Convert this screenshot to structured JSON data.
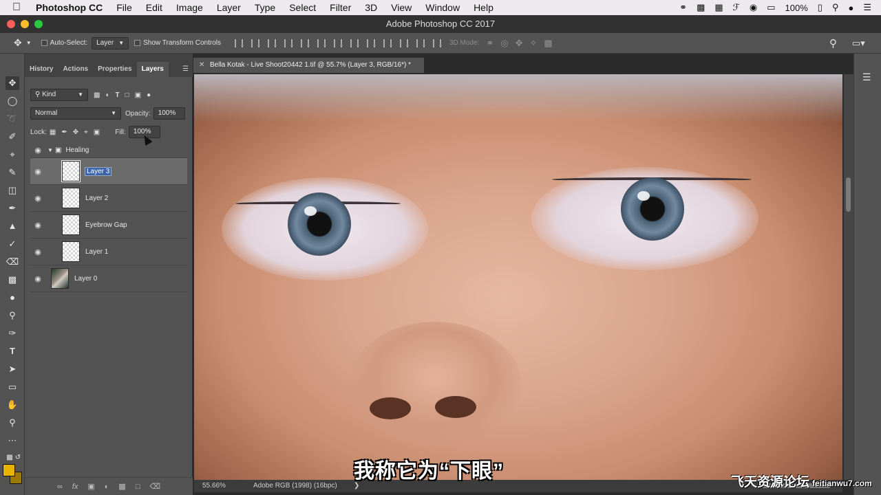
{
  "menubar": {
    "apple_icon": "apple-icon",
    "app_name": "Photoshop CC",
    "items": [
      "File",
      "Edit",
      "Image",
      "Layer",
      "Type",
      "Select",
      "Filter",
      "3D",
      "View",
      "Window",
      "Help"
    ],
    "battery": "100%"
  },
  "window": {
    "title": "Adobe Photoshop CC 2017"
  },
  "options": {
    "auto_select_label": "Auto-Select:",
    "auto_select_value": "Layer",
    "transform_label": "Show Transform Controls",
    "mode_3d": "3D Mode:"
  },
  "panel": {
    "tabs": [
      "History",
      "Actions",
      "Properties",
      "Layers"
    ],
    "active_tab": "Layers",
    "filter_kind": "Kind",
    "blend_mode": "Normal",
    "opacity_label": "Opacity:",
    "opacity_value": "100%",
    "lock_label": "Lock:",
    "fill_label": "Fill:",
    "fill_value": "100%",
    "group_name": "Healing",
    "layers": [
      {
        "name": "Layer 3",
        "selected": true
      },
      {
        "name": "Layer 2",
        "selected": false
      },
      {
        "name": "Eyebrow Gap",
        "selected": false
      },
      {
        "name": "Layer 1",
        "selected": false
      }
    ],
    "base_layer": "Layer 0"
  },
  "document": {
    "tab_title": "Bella Kotak - Live Shoot20442 1.tif @ 55.7% (Layer 3, RGB/16*) *",
    "zoom": "55.66%",
    "profile": "Adobe RGB (1998) (16bpc)"
  },
  "overlay": {
    "subtitle": "我称它为“下眼”",
    "watermark": "飞天资源论坛",
    "watermark_url": "feitianwu7.com"
  },
  "colors": {
    "foreground": "#e9b400",
    "background": "#9a7a00",
    "selection": "#3d63ae"
  }
}
